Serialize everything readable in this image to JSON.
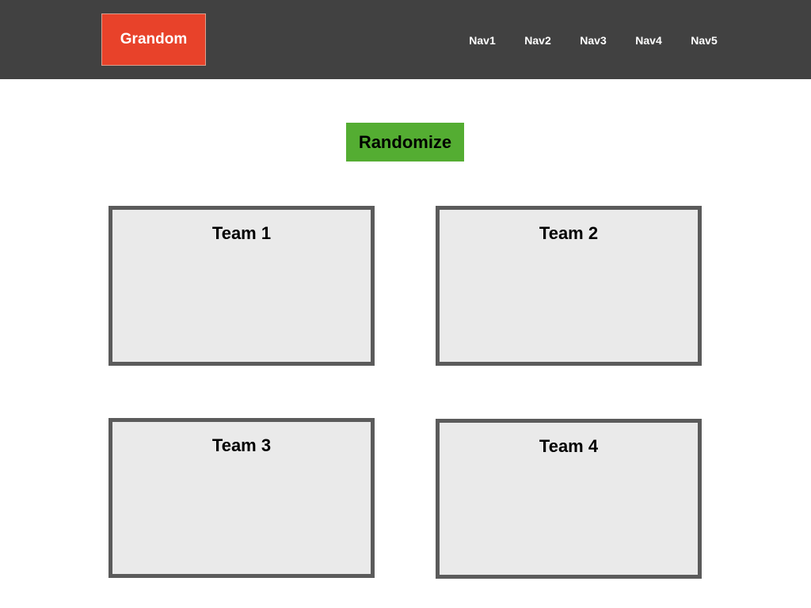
{
  "header": {
    "logo": "Grandom",
    "nav": [
      "Nav1",
      "Nav2",
      "Nav3",
      "Nav4",
      "Nav5"
    ]
  },
  "main": {
    "randomize_label": "Randomize",
    "teams": [
      {
        "title": "Team 1"
      },
      {
        "title": "Team 2"
      },
      {
        "title": "Team 3"
      },
      {
        "title": "Team 4"
      }
    ]
  },
  "colors": {
    "header_bg": "#414141",
    "logo_bg": "#e8422a",
    "button_bg": "#54ad32",
    "team_border": "#5b5b5b",
    "team_bg": "#eaeaea"
  }
}
